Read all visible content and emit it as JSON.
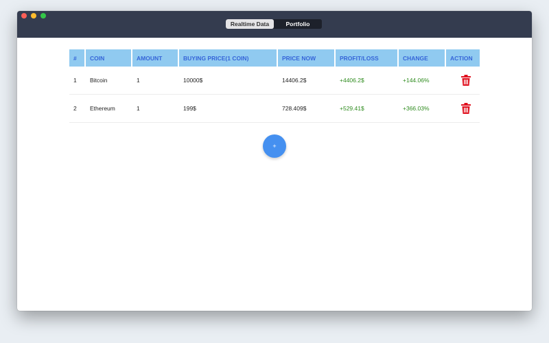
{
  "window": {
    "controls": [
      "close",
      "minimize",
      "maximize"
    ]
  },
  "tabs": [
    {
      "label": "Realtime Data",
      "active": false
    },
    {
      "label": "Portfolio",
      "active": true
    }
  ],
  "table": {
    "headers": [
      "#",
      "COIN",
      "AMOUNT",
      "BUYING PRICE(1 COIN)",
      "PRICE NOW",
      "PROFIT/LOSS",
      "CHANGE",
      "ACTION"
    ],
    "rows": [
      {
        "index": "1",
        "coin": "Bitcoin",
        "amount": "1",
        "buying_price": "10000$",
        "price_now": "14406.2$",
        "profit_loss": "+4406.2$",
        "change": "+144.06%",
        "action_icon": "trash-icon"
      },
      {
        "index": "2",
        "coin": "Ethereum",
        "amount": "1",
        "buying_price": "199$",
        "price_now": "728.409$",
        "profit_loss": "+529.41$",
        "change": "+366.03%",
        "action_icon": "trash-icon"
      }
    ]
  },
  "add_button": {
    "label": "+"
  },
  "colors": {
    "titlebar": "#343c4f",
    "header_bg": "#90caf0",
    "header_text": "#3565d8",
    "positive": "#2e8b1e",
    "delete": "#e0101e",
    "fab": "#4590f0"
  }
}
